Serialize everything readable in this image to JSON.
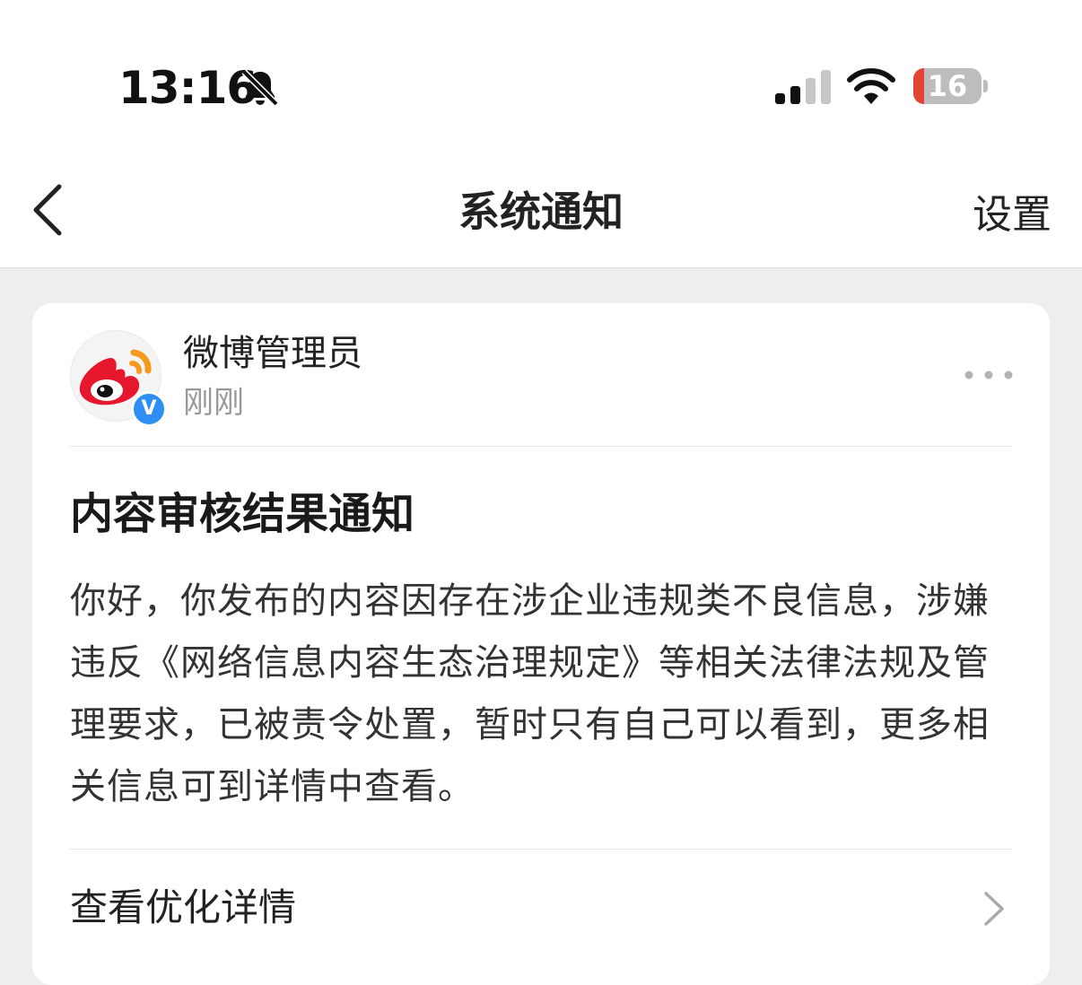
{
  "status_bar": {
    "time": "13:16",
    "battery_level": "16",
    "icons": [
      "bell-slash-icon",
      "signal-icon",
      "wifi-icon",
      "battery-icon"
    ]
  },
  "nav": {
    "back_icon": "chevron-left-icon",
    "title": "系统通知",
    "settings_label": "设置"
  },
  "message": {
    "sender": "微博管理员",
    "sender_verified_badge": "V",
    "timestamp": "刚刚",
    "more_icon": "more-dots-icon",
    "title": "内容审核结果通知",
    "body": "你好，你发布的内容因存在涉企业违规类不良信息，涉嫌违反《网络信息内容生态治理规定》等相关法律法规及管理要求，已被责令处置，暂时只有自己可以看到，更多相关信息可到详情中查看。",
    "details_label": "查看优化详情",
    "details_icon": "chevron-right-icon"
  },
  "colors": {
    "background": "#eeeeee",
    "card": "#ffffff",
    "secondary_text": "#999999",
    "verified_blue": "#2e8ef3",
    "battery_low_red": "#e64338",
    "weibo_red": "#e6162d",
    "weibo_orange": "#f59a1f"
  }
}
